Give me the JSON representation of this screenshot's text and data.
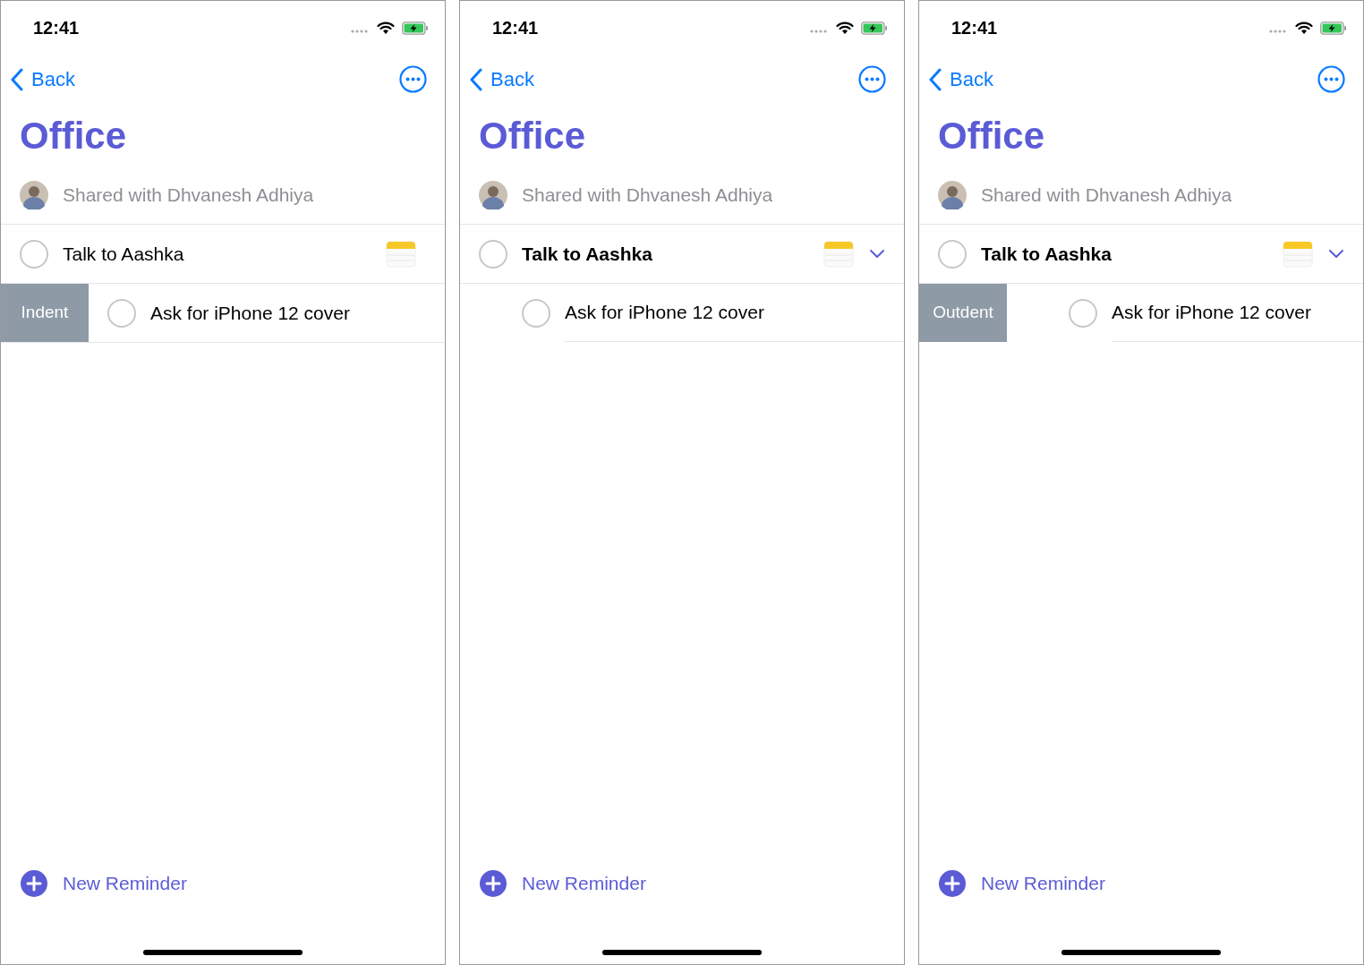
{
  "screens": [
    {
      "status_bar": {
        "time": "12:41"
      },
      "nav": {
        "back": "Back"
      },
      "title": "Office",
      "shared": "Shared with Dhvanesh Adhiya",
      "reminders": [
        {
          "title": "Talk to Aashka",
          "checked": false,
          "has_note": true
        },
        {
          "title": "Ask for iPhone 12 cover",
          "checked": false,
          "swipe_action": "Indent"
        }
      ],
      "new_reminder": "New Reminder"
    },
    {
      "status_bar": {
        "time": "12:41"
      },
      "nav": {
        "back": "Back"
      },
      "title": "Office",
      "shared": "Shared with Dhvanesh Adhiya",
      "reminders": [
        {
          "title": "Talk to Aashka",
          "checked": false,
          "has_note": true,
          "expanded": true,
          "children": [
            {
              "title": "Ask for iPhone 12 cover",
              "checked": false
            }
          ]
        }
      ],
      "new_reminder": "New Reminder"
    },
    {
      "status_bar": {
        "time": "12:41"
      },
      "nav": {
        "back": "Back"
      },
      "title": "Office",
      "shared": "Shared with Dhvanesh Adhiya",
      "reminders": [
        {
          "title": "Talk to Aashka",
          "checked": false,
          "has_note": true,
          "expanded": true,
          "children": [
            {
              "title": "Ask for iPhone 12 cover",
              "checked": false,
              "swipe_action": "Outdent"
            }
          ]
        }
      ],
      "new_reminder": "New Reminder"
    }
  ]
}
